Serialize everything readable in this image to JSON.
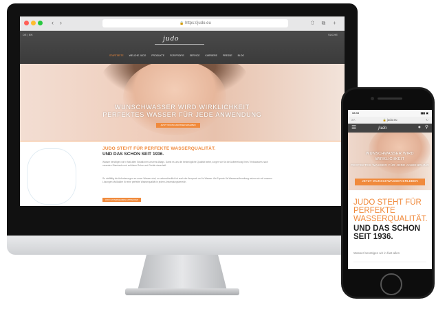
{
  "desktop": {
    "browser": {
      "url": "https://judo.eu",
      "back_icon": "chevron-left-icon",
      "forward_icon": "chevron-right-icon"
    },
    "site": {
      "logo": "judo",
      "lang": "DE | EN",
      "search": "SUCHE",
      "menu": [
        "STARTSEITE",
        "WELCHE JUDO",
        "PRODUKTE",
        "FÜR PROFIS",
        "SERVICE",
        "KARRIERE",
        "PRESSE",
        "BLOG"
      ],
      "hero_line1": "WUNSCHWASSER WIRD WIRKLICHKEIT",
      "hero_line2": "PERFEKTES WASSER FÜR JEDE ANWENDUNG",
      "hero_button": "JETZT WUNSCHWASSER ERLEBEN",
      "heading_orange": "JUDO STEHT FÜR PERFEKTE WASSERQUALITÄT.",
      "heading_dark": "UND DAS SCHON SEIT 1936.",
      "para1": "Wasser benötigen wir in fast allen Situationen unseres Alltags. Damit es uns die bestmögliche Qualität bietet, sorgen wir für die Aufbereitung Ihres Trinkwassers nach neuesten Standards und schützen Rohre und Geräte dauerhaft.",
      "para2": "So vielfältig die Anforderungen an unser Wasser sind, so unterschiedlich ist auch der Anspruch an Ihr Wasser. Als Experte für Wasseraufbereitung setzen wir mit unseren Lösungen Maßstäbe für eine perfekte Wasserqualität in jedem Anwendungsbereich.",
      "content_button": "JUDO UNTERNEHMEN ENTDECKEN"
    }
  },
  "mobile": {
    "time": "08:33",
    "url": "judo.eu",
    "logo": "judo",
    "hero_line1": "WUNSCHWASSER WIRD",
    "hero_line2": "WIRKLICHKEIT",
    "hero_line3": "PERFEKTES WASSER FÜR JEDE ANWENDUNG",
    "hero_button": "JETZT WUNSCHWASSER ERLEBEN",
    "heading_orange": "JUDO STEHT FÜR PERFEKTE WASSERQUALITÄT.",
    "heading_dark": "UND DAS SCHON SEIT 1936.",
    "para": "Wasser benötigen wir in fast allen",
    "menu_icon": "hamburger-icon",
    "globe_icon": "globe-icon",
    "search_icon": "search-icon"
  },
  "colors": {
    "accent": "#f08a3c",
    "nav_bg": "#3f3f3f"
  }
}
